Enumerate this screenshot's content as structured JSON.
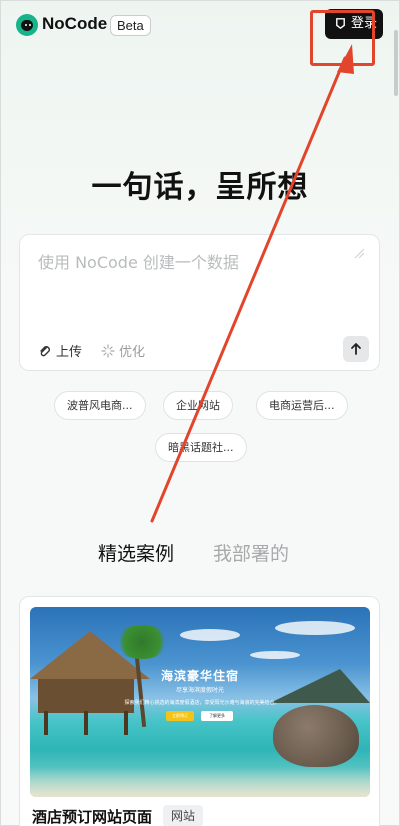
{
  "header": {
    "brand": "NoCode",
    "badge": "Beta",
    "login_label": "登录"
  },
  "hero": {
    "title": "一句话，呈所想"
  },
  "prompt": {
    "placeholder": "使用 NoCode 创建一个数据",
    "upload_label": "上传",
    "optimize_label": "优化"
  },
  "chips": [
    "波普风电商...",
    "企业网站",
    "电商运营后...",
    "暗黑话题社..."
  ],
  "tabs": {
    "featured": "精选案例",
    "mine": "我部署的"
  },
  "case": {
    "name": "酒店预订网站页面",
    "tag": "网站",
    "preview_title": "海滨豪华住宿",
    "preview_subtitle": "尽享海滨度假时光",
    "preview_desc": "探索我们精心挑选的海滨度假酒店，享受阳光沙滩与海浪的完美结合。",
    "preview_btn_primary": "立即预订",
    "preview_btn_secondary": "了解更多"
  },
  "colors": {
    "brand": "#17b38a",
    "dark_button": "#111111",
    "annotation": "#e2452b"
  }
}
